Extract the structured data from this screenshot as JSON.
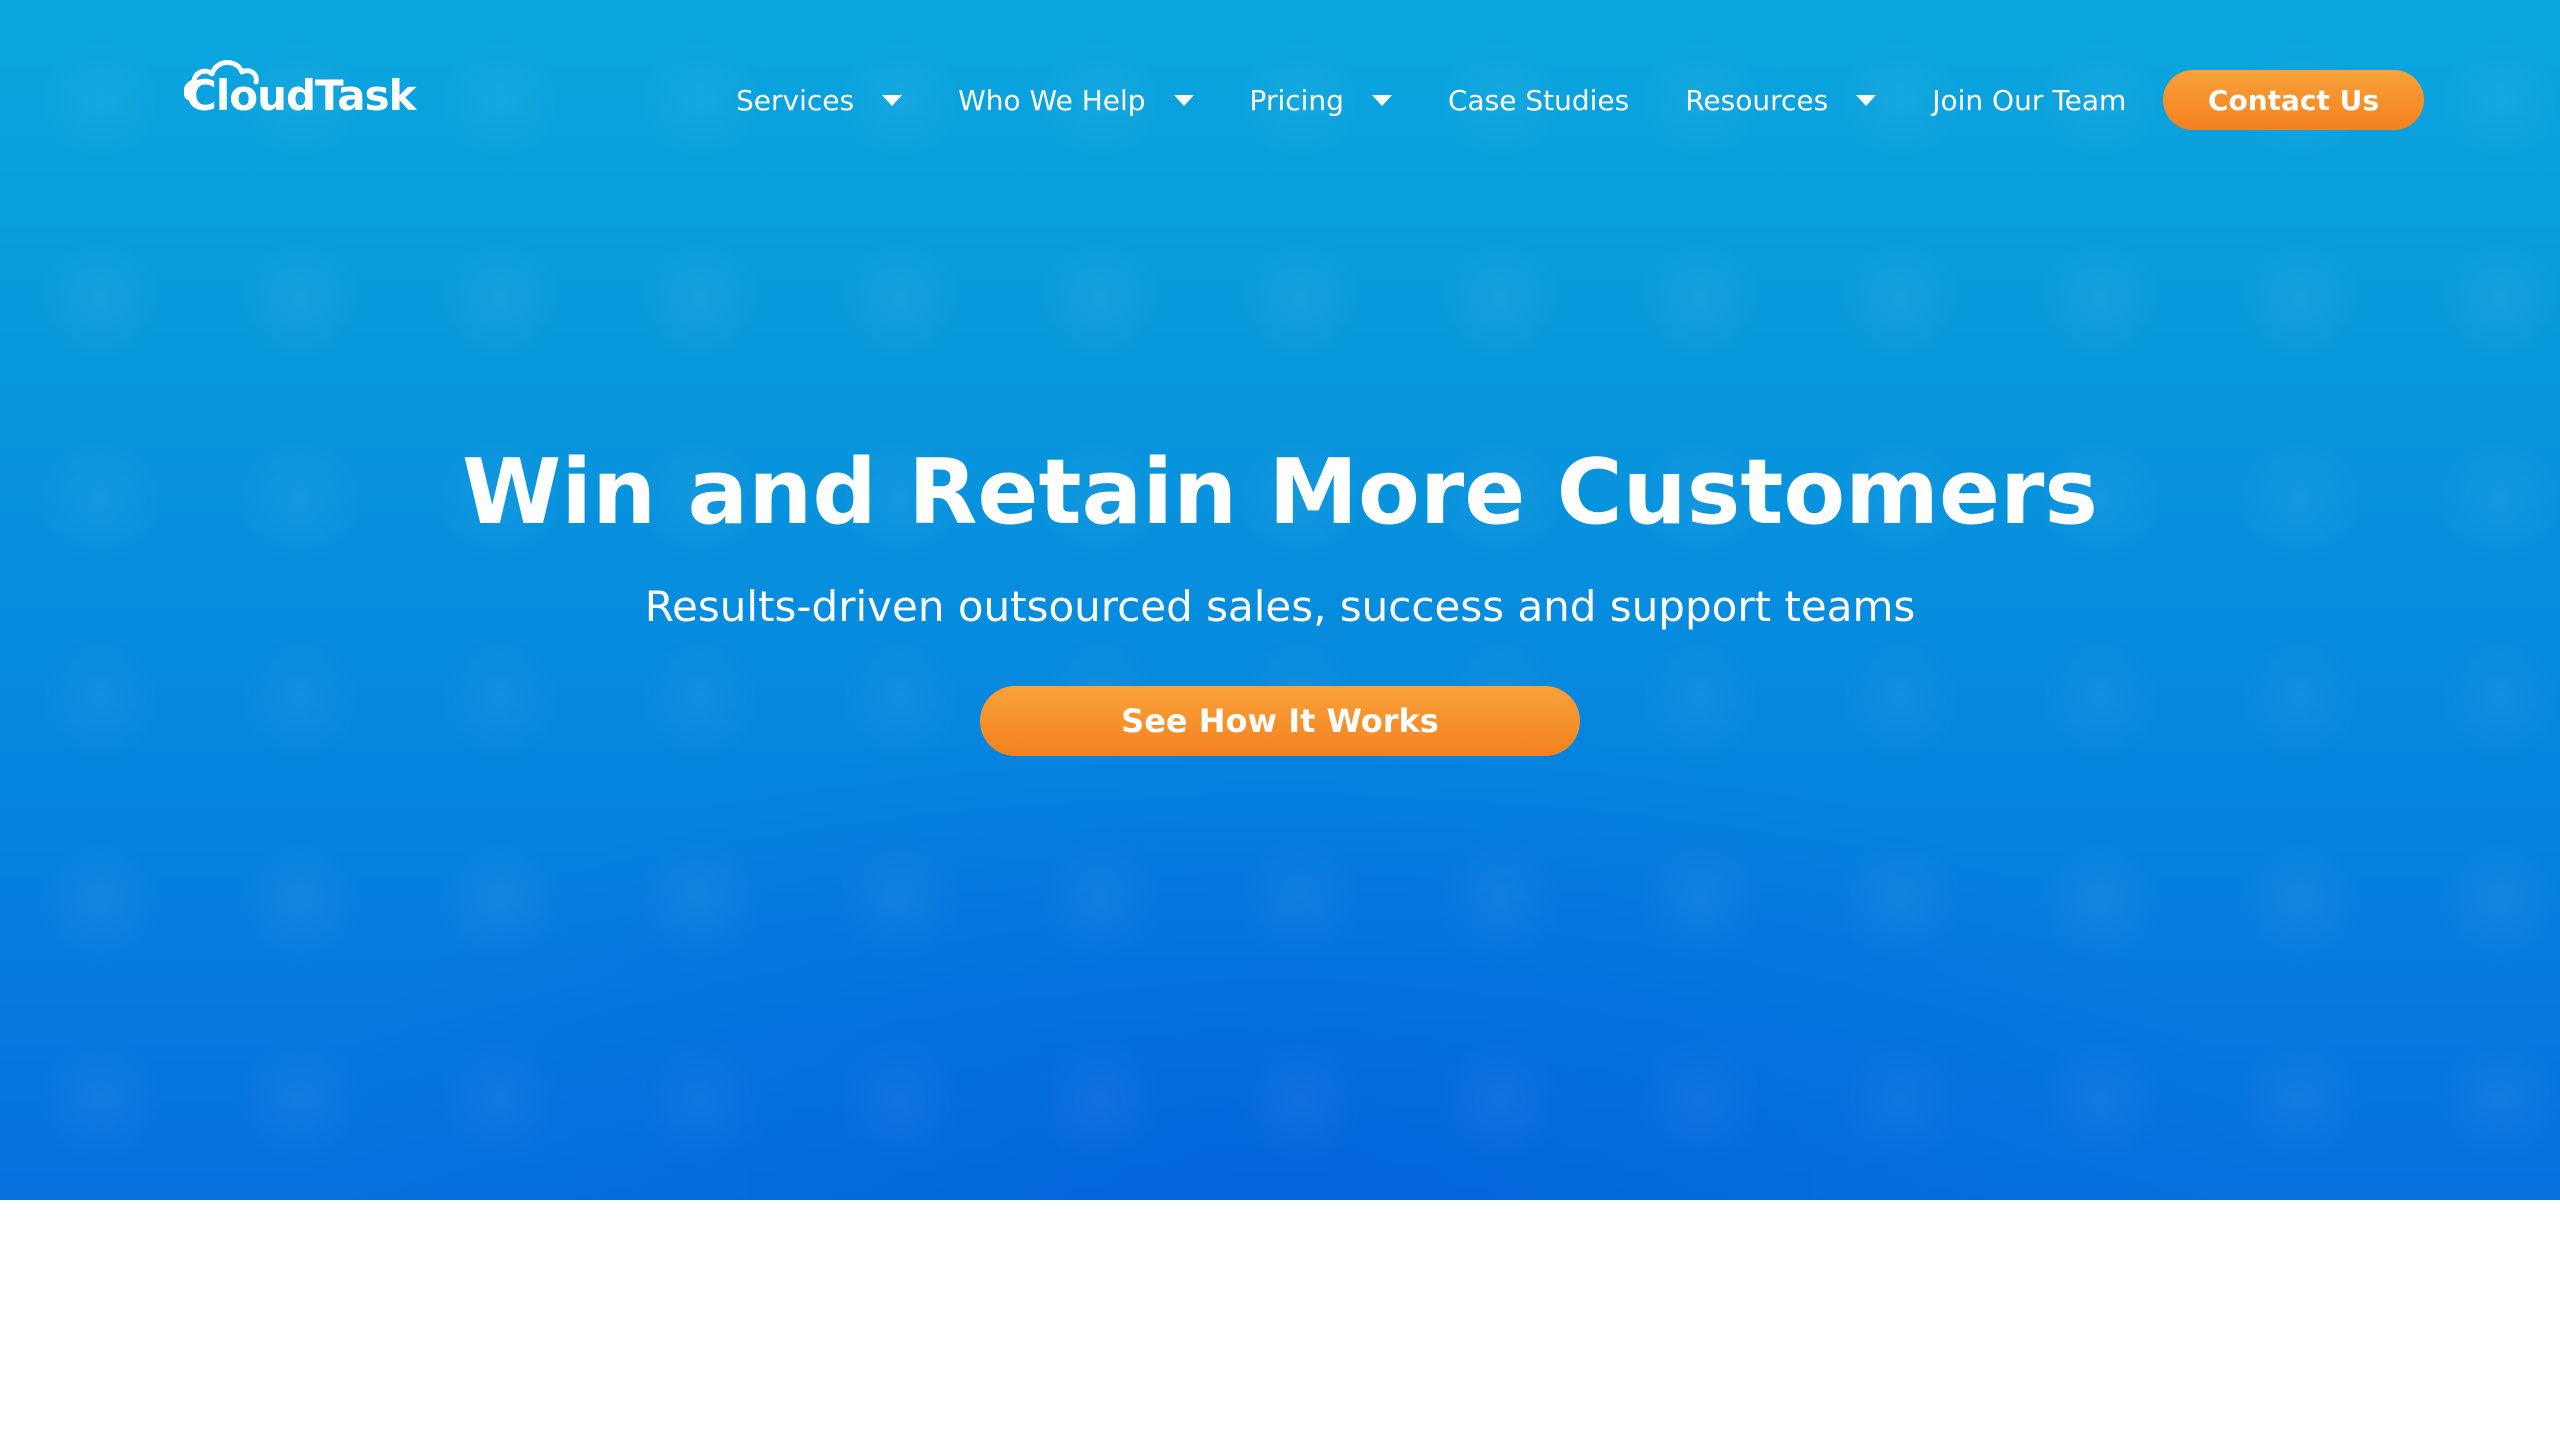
{
  "brand": {
    "name": "CloudTask",
    "logo_icon": "cloud-icon"
  },
  "nav": {
    "items": [
      {
        "label": "Services",
        "has_dropdown": true
      },
      {
        "label": "Who We Help",
        "has_dropdown": true
      },
      {
        "label": "Pricing",
        "has_dropdown": true
      },
      {
        "label": "Case Studies",
        "has_dropdown": false
      },
      {
        "label": "Resources",
        "has_dropdown": true
      },
      {
        "label": "Join Our Team",
        "has_dropdown": false
      }
    ],
    "contact_label": "Contact Us"
  },
  "hero": {
    "title": "Win and Retain More Customers",
    "subtitle": "Results-driven outsourced sales, success and support teams",
    "cta_label": "See How It Works"
  },
  "colors": {
    "hero_blue": "#0896dc",
    "accent_orange": "#f4811f",
    "text": "#ffffff"
  }
}
